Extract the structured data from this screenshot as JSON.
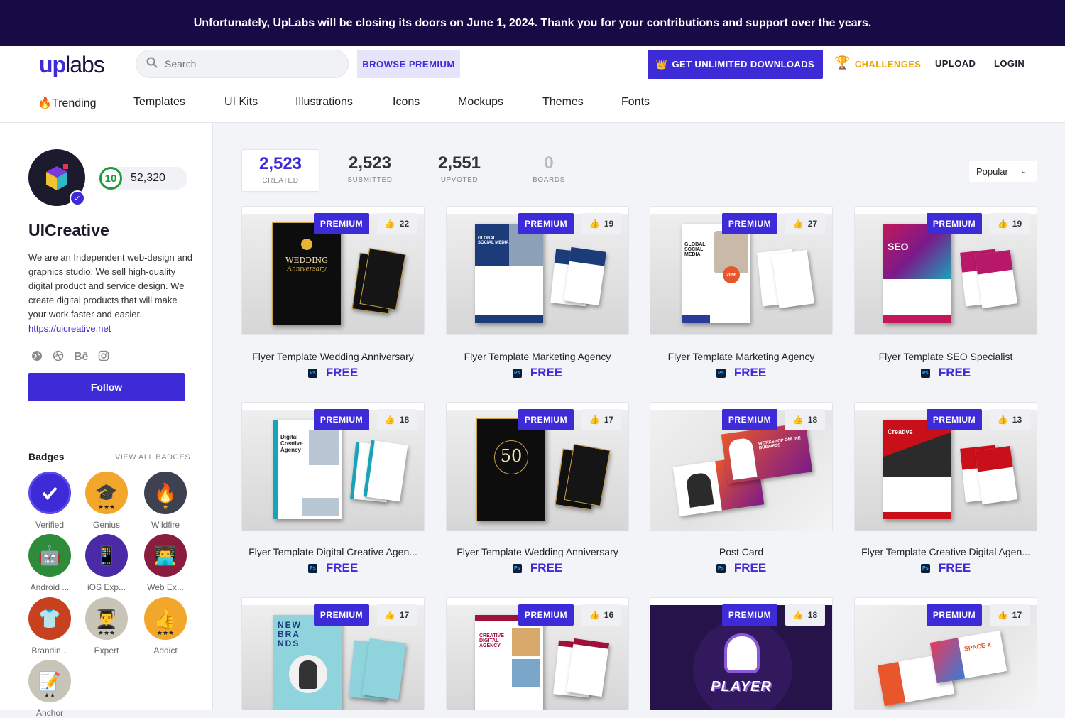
{
  "banner": {
    "text": "Unfortunately, UpLabs will be closing its doors on June 1, 2024. Thank you for your contributions and support over the years."
  },
  "header": {
    "logo_up": "up",
    "logo_labs": "labs",
    "search_placeholder": "Search",
    "browse_premium": "BROWSE PREMIUM",
    "unlimited_downloads": "GET UNLIMITED DOWNLOADS",
    "challenges": "CHALLENGES",
    "upload": "UPLOAD",
    "login": "LOGIN",
    "accent_color": "#3d2bd8",
    "challenges_color": "#e8a600"
  },
  "nav": {
    "trending": "🔥Trending",
    "templates": "Templates",
    "ui_kits": "UI Kits",
    "illustrations": "Illustrations",
    "icons": "Icons",
    "mockups": "Mockups",
    "themes": "Themes",
    "fonts": "Fonts"
  },
  "profile": {
    "level": "10",
    "points": "52,320",
    "name": "UICreative",
    "bio": "We are an Independent web-design and graphics studio. We sell high-quality digital product and service design. We create digital products that will make your work faster and easier. -",
    "link": "https://uicreative.net",
    "follow": "Follow"
  },
  "badges": {
    "title": "Badges",
    "view_all": "VIEW ALL BADGES",
    "items": [
      {
        "label": "Verified",
        "icon": "check-icon"
      },
      {
        "label": "Genius",
        "icon": "graduation-cap-icon"
      },
      {
        "label": "Wildfire",
        "icon": "fire-icon"
      },
      {
        "label": "Android ...",
        "icon": "robot-icon"
      },
      {
        "label": "iOS Exp...",
        "icon": "phone-icon"
      },
      {
        "label": "Web Ex...",
        "icon": "laptop-user-icon"
      },
      {
        "label": "Brandin...",
        "icon": "shirt-icon"
      },
      {
        "label": "Expert",
        "icon": "expert-icon"
      },
      {
        "label": "Addict",
        "icon": "thumbs-up-icon"
      },
      {
        "label": "Anchor",
        "icon": "notepad-icon"
      }
    ]
  },
  "stats": {
    "created": {
      "value": "2,523",
      "label": "CREATED"
    },
    "submitted": {
      "value": "2,523",
      "label": "SUBMITTED"
    },
    "upvoted": {
      "value": "2,551",
      "label": "UPVOTED"
    },
    "boards": {
      "value": "0",
      "label": "BOARDS"
    }
  },
  "sort": {
    "selected": "Popular"
  },
  "cards": [
    {
      "title": "Flyer Template Wedding Anniversary",
      "likes": "22",
      "price": "FREE",
      "badge": "PREMIUM"
    },
    {
      "title": "Flyer Template Marketing Agency",
      "likes": "19",
      "price": "FREE",
      "badge": "PREMIUM"
    },
    {
      "title": "Flyer Template Marketing Agency",
      "likes": "27",
      "price": "FREE",
      "badge": "PREMIUM"
    },
    {
      "title": "Flyer Template SEO Specialist",
      "likes": "19",
      "price": "FREE",
      "badge": "PREMIUM"
    },
    {
      "title": "Flyer Template Digital Creative Agen...",
      "likes": "18",
      "price": "FREE",
      "badge": "PREMIUM"
    },
    {
      "title": "Flyer Template Wedding Anniversary",
      "likes": "17",
      "price": "FREE",
      "badge": "PREMIUM"
    },
    {
      "title": "Post Card",
      "likes": "18",
      "price": "FREE",
      "badge": "PREMIUM"
    },
    {
      "title": "Flyer Template Creative Digital Agen...",
      "likes": "13",
      "price": "FREE",
      "badge": "PREMIUM"
    },
    {
      "title": "",
      "likes": "17",
      "price": "",
      "badge": "PREMIUM"
    },
    {
      "title": "",
      "likes": "16",
      "price": "",
      "badge": "PREMIUM"
    },
    {
      "title": "",
      "likes": "18",
      "price": "",
      "badge": "PREMIUM"
    },
    {
      "title": "",
      "likes": "17",
      "price": "",
      "badge": "PREMIUM"
    }
  ],
  "ps_label": "Ps",
  "thumb_text": {
    "wedding": "WEDDING",
    "anniversary": "Anniversary",
    "global": "GLOBAL SOCIAL MEDIA",
    "seo": "SEO",
    "digital_creative": "Digital Creative Agency",
    "fifty": "50",
    "creative": "Creative",
    "new_brands": "NEW BRA NDS",
    "creative_digital_agency": "CREATIVE DIGITAL AGENCY",
    "player": "PLAYER",
    "space_x": "SPACE X",
    "workshop": "WORKSHOP ONLINE BUSINESS",
    "discount": "20%"
  }
}
